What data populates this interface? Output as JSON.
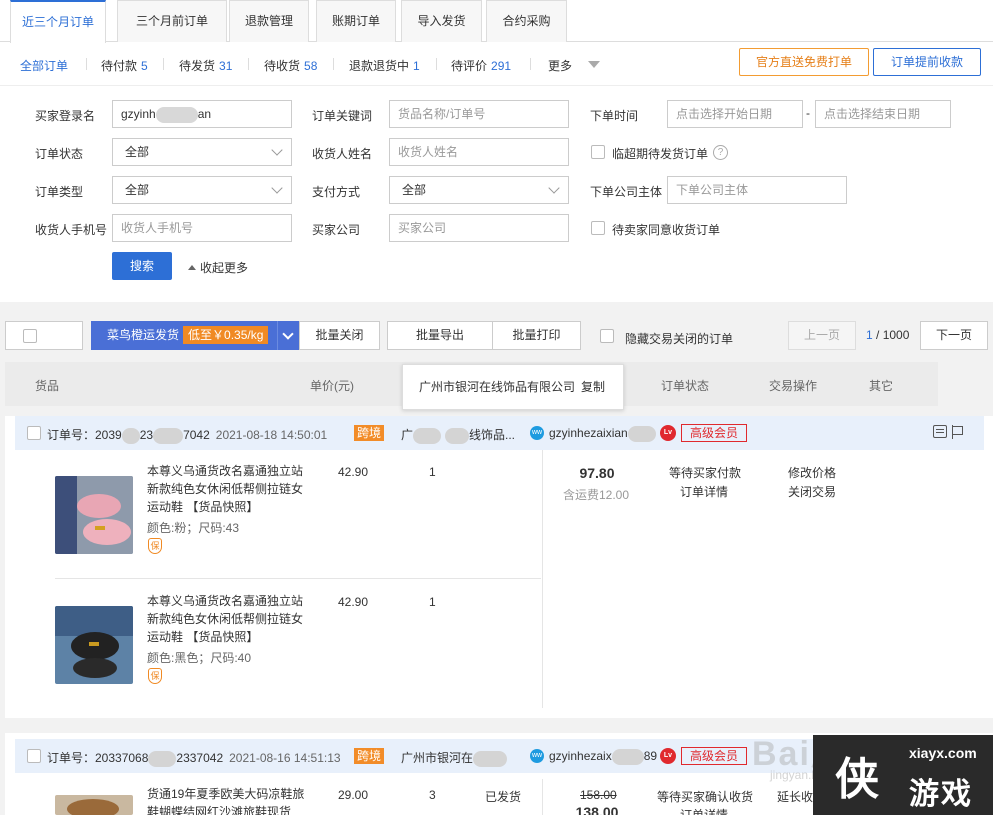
{
  "tabs": [
    {
      "label": "近三个月订单"
    },
    {
      "label": "三个月前订单"
    },
    {
      "label": "退款管理"
    },
    {
      "label": "账期订单"
    },
    {
      "label": "导入发货"
    },
    {
      "label": "合约采购"
    }
  ],
  "status_filters": [
    {
      "label": "全部订单",
      "count": ""
    },
    {
      "label": "待付款",
      "count": "5"
    },
    {
      "label": "待发货",
      "count": "31"
    },
    {
      "label": "待收货",
      "count": "58"
    },
    {
      "label": "退款退货中",
      "count": "1"
    },
    {
      "label": "待评价",
      "count": "291"
    },
    {
      "label": "更多",
      "count": ""
    }
  ],
  "actions": {
    "free_print": "官方直送免费打单",
    "early_collect": "订单提前收款"
  },
  "filters": {
    "buyer_login_label": "买家登录名",
    "buyer_login_value_prefix": "gzyinh",
    "buyer_login_value_suffix": "an",
    "keyword_label": "订单关键词",
    "keyword_placeholder": "货品名称/订单号",
    "order_time_label": "下单时间",
    "start_date_placeholder": "点击选择开始日期",
    "date_sep": "-",
    "end_date_placeholder": "点击选择结束日期",
    "order_status_label": "订单状态",
    "order_status_value": "全部",
    "receiver_name_label": "收货人姓名",
    "receiver_name_placeholder": "收货人姓名",
    "overdue_label": "临超期待发货订单",
    "help_glyph": "?",
    "order_type_label": "订单类型",
    "order_type_value": "全部",
    "pay_method_label": "支付方式",
    "pay_method_value": "全部",
    "company_label": "下单公司主体",
    "company_placeholder": "下单公司主体",
    "receiver_phone_label": "收货人手机号",
    "receiver_phone_placeholder": "收货人手机号",
    "buyer_company_label": "买家公司",
    "buyer_company_placeholder": "买家公司",
    "pending_agree_label": "待卖家同意收货订单",
    "search_button": "搜索",
    "collapse_label": "收起更多"
  },
  "toolbar": {
    "cainiao_label": "菜鸟橙运发货",
    "cainiao_price": "低至￥0.35/kg",
    "batch_close": "批量关闭",
    "batch_export": "批量导出",
    "batch_print": "批量打印",
    "hide_closed": "隐藏交易关闭的订单",
    "prev_page": "上一页",
    "page_current": "1",
    "page_total": " / 1000",
    "next_page": "下一页"
  },
  "table_headers": {
    "goods": "货品",
    "unit_price": "单价(元)",
    "order_status": "订单状态",
    "trade_ops": "交易操作",
    "other": "其它"
  },
  "popover": {
    "company": "广州市银河在线饰品有限公司",
    "copy": "复制"
  },
  "orders": [
    {
      "order_no_prefix": "订单号：2039",
      "order_no_mid": "23",
      "order_no_suffix": "7042",
      "date": "2021-08-18 14:50:01",
      "tag": "跨境",
      "company_prefix": "广",
      "company_suffix": "线饰品...",
      "ww_glyph": "ww",
      "buyer": "gzyinhezaixian",
      "level_glyph": "Lv",
      "vip": "高级会员",
      "total": "97.80",
      "shipping": "含运费12.00",
      "status_line1": "等待买家付款",
      "status_line2": "订单详情",
      "op_line1": "修改价格",
      "op_line2": "关闭交易",
      "items": [
        {
          "title": "本尊义乌通货改名嘉通独立站新款纯色女休闲低帮侧拉链女运动鞋 【货品快照】",
          "attr": "颜色:粉；尺码:43",
          "bao": "保",
          "price": "42.90",
          "qty": "1",
          "img_color": "#e8a6b4"
        },
        {
          "title": "本尊义乌通货改名嘉通独立站新款纯色女休闲低帮侧拉链女运动鞋 【货品快照】",
          "attr": "颜色:黑色；尺码:40",
          "bao": "保",
          "price": "42.90",
          "qty": "1",
          "img_color": "#2a2a2a"
        }
      ]
    },
    {
      "order_no_prefix": "订单号：20337068",
      "order_no_mid": "",
      "order_no_suffix": "2337042",
      "date": "2021-08-16 14:51:13",
      "tag": "跨境",
      "company_prefix": "广州市银河在",
      "company_suffix": "",
      "ww_glyph": "ww",
      "buyer": "gzyinhezaix",
      "buyer_suffix": "89",
      "level_glyph": "Lv",
      "vip": "高级会员",
      "total_old": "158.00",
      "total": "138.00",
      "status_line1": "等待买家确认收货",
      "status_line2": "订单详情",
      "op_line1": "延长收货时间",
      "items": [
        {
          "title": "货通19年夏季欧美大码凉鞋旅鞋蝴蝶结网红沙滩旅鞋现货",
          "price": "29.00",
          "qty": "3",
          "ship_status": "已发货",
          "img_color": "#b48a5a"
        }
      ]
    }
  ],
  "watermark": {
    "text": "Bai度经验",
    "sub": "jingyan.baidu.com"
  },
  "site_logo": {
    "big": "侠",
    "url": "xiayx.com",
    "game": "游戏"
  }
}
